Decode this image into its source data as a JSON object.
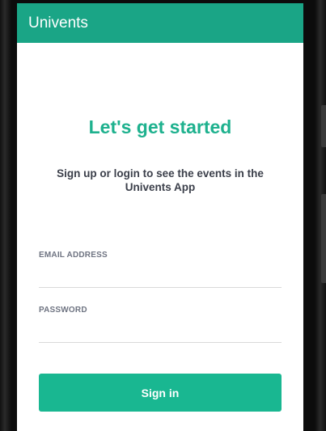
{
  "app_bar": {
    "title": "Univents"
  },
  "main": {
    "headline": "Let's get started",
    "subtitle": "Sign up or login to see the events in the Univents App"
  },
  "form": {
    "email_label": "EMAIL ADDRESS",
    "email_value": "",
    "password_label": "PASSWORD",
    "password_value": "",
    "signin_label": "Sign in"
  },
  "colors": {
    "app_bar": "#1aa586",
    "headline": "#1eb18e",
    "button": "#19b791",
    "body_text": "#3b3f4a",
    "label_text": "#6f7482"
  }
}
